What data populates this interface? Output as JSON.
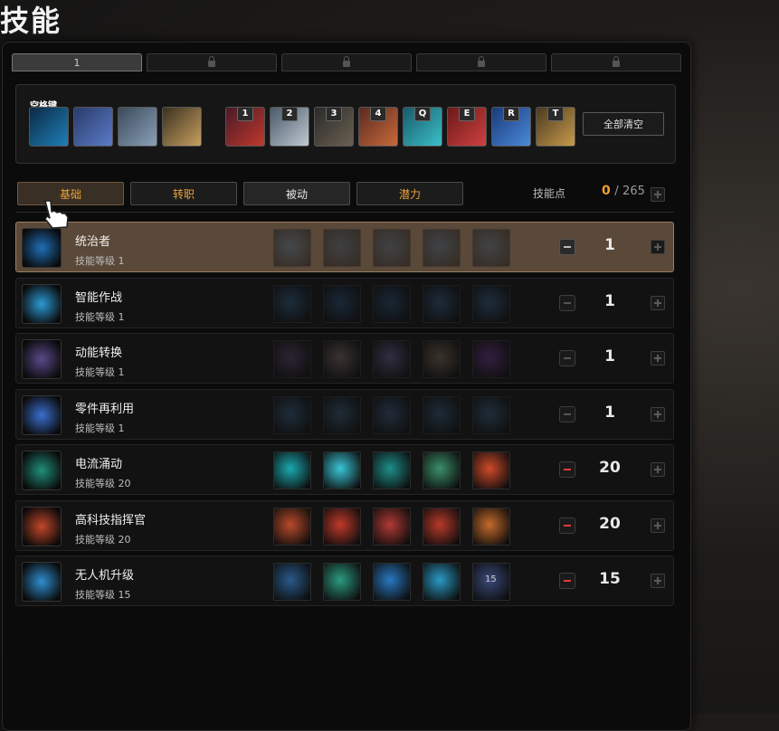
{
  "page": {
    "title": "技能"
  },
  "tabs": [
    {
      "label": "1",
      "active": true,
      "locked": false
    },
    {
      "label": "",
      "active": false,
      "locked": true
    },
    {
      "label": "",
      "active": false,
      "locked": true
    },
    {
      "label": "",
      "active": false,
      "locked": true
    },
    {
      "label": "",
      "active": false,
      "locked": true
    }
  ],
  "hotbar": {
    "space_key_label": "空格键",
    "keys": [
      "1",
      "2",
      "3",
      "4",
      "Q",
      "E",
      "R",
      "T"
    ],
    "clear_all_label": "全部清空"
  },
  "categories": [
    {
      "label": "基础",
      "style": "orange",
      "active": true
    },
    {
      "label": "转职",
      "style": "orange",
      "active": false
    },
    {
      "label": "被动",
      "style": "white",
      "active": false
    },
    {
      "label": "潜力",
      "style": "orange",
      "active": false
    }
  ],
  "skill_points": {
    "label": "技能点",
    "current": "0",
    "separator": "/",
    "total": "265"
  },
  "skills": [
    {
      "name": "统治者",
      "level_text": "技能等级 1",
      "value": "1",
      "selected": true,
      "dim": true,
      "minus": "dark",
      "icon_color": "#1f6fb8",
      "tier_colors": [
        "#2a4a66",
        "#1c3550",
        "#203a55",
        "#1d3d5c",
        "#233d58"
      ]
    },
    {
      "name": "智能作战",
      "level_text": "技能等级 1",
      "value": "1",
      "selected": false,
      "dim": true,
      "minus": "none",
      "icon_color": "#2d9ad6",
      "tier_colors": [
        "#2a4d6e",
        "#224262",
        "#20405e",
        "#2a4a6a",
        "#2d4f70"
      ]
    },
    {
      "name": "动能转换",
      "level_text": "技能等级 1",
      "value": "1",
      "selected": false,
      "dim": true,
      "minus": "none",
      "icon_color": "#5a4a8a",
      "tier_colors": [
        "#4a3a5a",
        "#6a5a58",
        "#55507a",
        "#6b5a4a",
        "#5a2f78"
      ]
    },
    {
      "name": "零件再利用",
      "level_text": "技能等级 1",
      "value": "1",
      "selected": false,
      "dim": true,
      "minus": "none",
      "icon_color": "#3b6fd0",
      "tier_colors": [
        "#2d4d6a",
        "#2f4c64",
        "#334a6a",
        "#2b4a66",
        "#2f4e6a"
      ]
    },
    {
      "name": "电流涌动",
      "level_text": "技能等级 20",
      "value": "20",
      "selected": false,
      "dim": false,
      "minus": "red",
      "icon_color": "#1f8f7a",
      "tier_colors": [
        "#1aa9b0",
        "#39c6d6",
        "#1e8e8a",
        "#3b8f6a",
        "#d04a2a"
      ]
    },
    {
      "name": "高科技指挥官",
      "level_text": "技能等级 20",
      "value": "20",
      "selected": false,
      "dim": false,
      "minus": "red",
      "icon_color": "#c2472a",
      "tier_colors": [
        "#b84b2a",
        "#c0392b",
        "#b03a35",
        "#b83a2a",
        "#c46a2a"
      ]
    },
    {
      "name": "无人机升级",
      "level_text": "技能等级 15",
      "value": "15",
      "selected": false,
      "dim": false,
      "minus": "red",
      "icon_color": "#2f8fd0",
      "tier_colors": [
        "#2a5a8a",
        "#2c9a80",
        "#2878c0",
        "#2a9ac4",
        "#3a4a7a"
      ],
      "tier_badge": "15"
    }
  ],
  "colors": {
    "accent": "#f0a030",
    "panel_bg": "#0b0b0b",
    "selected_row": "#5a4838",
    "danger": "#e23a3a"
  },
  "icons": {
    "cursor": "pointing-hand-cursor-icon",
    "lock": "lock-icon"
  }
}
